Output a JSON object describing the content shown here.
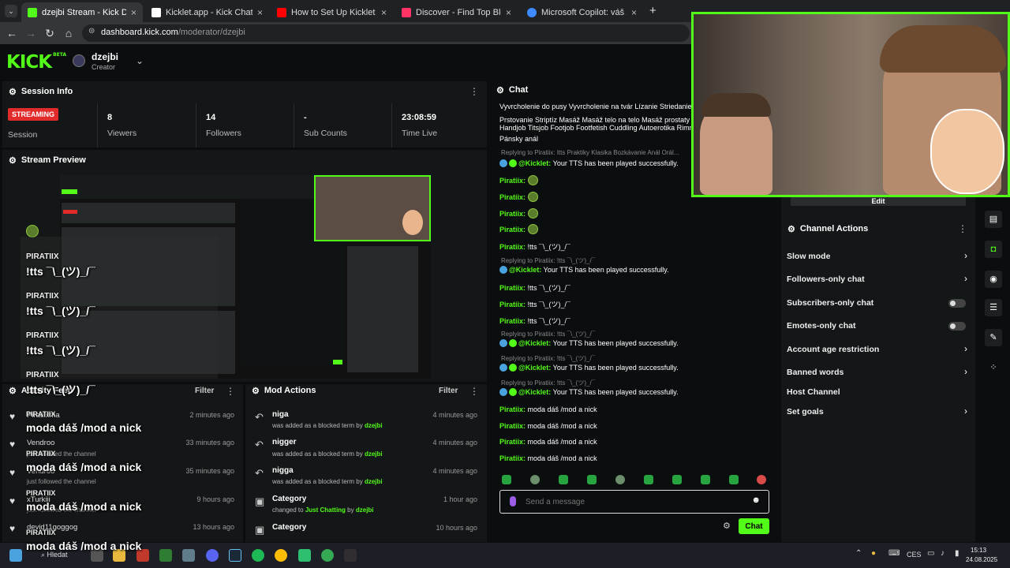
{
  "browser": {
    "tabs": [
      {
        "title": "dzejbi Stream - Kick Dashboard",
        "color": "#53fc18"
      },
      {
        "title": "Kicklet.app - Kick Chatbot and ...",
        "color": "#ffffff"
      },
      {
        "title": "How to Set Up Kicklet for Your ...",
        "color": "#ff0000"
      },
      {
        "title": "Discover - Find Top Blerps, Stre...",
        "color": "#ff3366"
      },
      {
        "title": "Microsoft Copilot: váš AI pomo...",
        "color": "#3d8bff"
      }
    ],
    "url_domain": "dashboard.kick.com",
    "url_path": "/moderator/dzejbi"
  },
  "header": {
    "logo": "KICK",
    "logo_badge": "BETA",
    "username": "dzejbi",
    "role": "Creator"
  },
  "session_info": {
    "title": "Session Info",
    "status_badge": "STREAMING",
    "session_label": "Session",
    "stats": [
      {
        "value": "8",
        "label": "Viewers"
      },
      {
        "value": "14",
        "label": "Followers"
      },
      {
        "value": "-",
        "label": "Sub Counts"
      },
      {
        "value": "23:08:59",
        "label": "Time Live"
      }
    ]
  },
  "stream_preview": {
    "title": "Stream Preview"
  },
  "overlay": {
    "messages": [
      {
        "name": "PIRATIIX",
        "text": "!tts ¯\\_(ツ)_/¯"
      },
      {
        "name": "PIRATIIX",
        "text": "!tts ¯\\_(ツ)_/¯"
      },
      {
        "name": "PIRATIIX",
        "text": "!tts ¯\\_(ツ)_/¯"
      },
      {
        "name": "PIRATIIX",
        "text": "!tts ¯\\_(ツ)_/¯"
      },
      {
        "name": "PIRATIIX",
        "text": "moda dáš /mod a nick"
      },
      {
        "name": "PIRATIIX",
        "text": "moda dáš /mod a nick"
      },
      {
        "name": "PIRATIIX",
        "text": "moda dáš /mod a nick"
      },
      {
        "name": "PIRATIIX",
        "text": "moda dáš /mod a nick"
      }
    ]
  },
  "activity_feed": {
    "title": "Activity Feed",
    "filter": "Filter",
    "items": [
      {
        "name": "Piratiixma",
        "sub": "just followed the channel",
        "time": "2 minutes ago"
      },
      {
        "name": "Vendroo",
        "sub": "just followed the channel",
        "time": "33 minutes ago"
      },
      {
        "name": "Vendroo",
        "sub": "just followed the channel",
        "time": "35 minutes ago"
      },
      {
        "name": "xTurkiii",
        "sub": "just followed the channel",
        "time": "9 hours ago"
      },
      {
        "name": "devid11goggog",
        "sub": "just followed the channel",
        "time": "13 hours ago"
      }
    ]
  },
  "mod_actions": {
    "title": "Mod Actions",
    "filter": "Filter",
    "items": [
      {
        "name": "niga",
        "pre": "was added as a blocked term by",
        "target": "",
        "by": "dzejbi",
        "time": "4 minutes ago"
      },
      {
        "name": "nigger",
        "pre": "was added as a blocked term by",
        "target": "",
        "by": "dzejbi",
        "time": "4 minutes ago"
      },
      {
        "name": "nigga",
        "pre": "was added as a blocked term by",
        "target": "",
        "by": "dzejbi",
        "time": "4 minutes ago"
      },
      {
        "name": "Category",
        "pre": "changed to",
        "target": "Just Chatting",
        "by": "dzejbi",
        "time": "1 hour ago"
      },
      {
        "name": "Category",
        "pre": "changed to",
        "target": "",
        "by": "",
        "time": "10 hours ago"
      }
    ]
  },
  "chat": {
    "title": "Chat",
    "top_lines": [
      "Vyvrcholenie do pusy Vyvrcholenie na tvár Lízanie Striedanie",
      "Prstovanie Striptíz Masáž Masáž telo na telo Masáž prostaty",
      "Handjob Titsjob Footjob Footfetish Cuddling Autoerotika Rimming",
      "Pánsky anál"
    ],
    "reply_prefix": "Replying to Piratiix:",
    "reply_first": "Replying to Piratiix: Itts Praktiky Klasika Bozkávanie Anál Orál...",
    "reply_tts": "Replying to Piratiix: !tts ¯\\_(ツ)_/¯",
    "kicklet_name": "@Kicklet:",
    "tts_text": "Your TTS has been played successfully.",
    "piratiix": "Piratiix:",
    "tts_cmd": "!tts ¯\\_(ツ)_/¯",
    "mod_text": "moda dáš /mod a nick",
    "input_placeholder": "Send a message",
    "send_label": "Chat"
  },
  "right_panel": {
    "edit_label": "Edit",
    "title": "Channel Actions",
    "actions": [
      {
        "label": "Slow mode",
        "control": "chevron"
      },
      {
        "label": "Followers-only chat",
        "control": "chevron"
      },
      {
        "label": "Subscribers-only chat",
        "control": "toggle"
      },
      {
        "label": "Emotes-only chat",
        "control": "toggle"
      },
      {
        "label": "Account age restriction",
        "control": "chevron"
      },
      {
        "label": "Banned words",
        "control": "chevron"
      },
      {
        "label": "Host Channel",
        "control": "none"
      },
      {
        "label": "Set goals",
        "control": "chevron"
      }
    ]
  },
  "taskbar": {
    "search_placeholder": "Hledat",
    "lang": "CES",
    "time": "15:13",
    "date": "24.08.2025"
  }
}
